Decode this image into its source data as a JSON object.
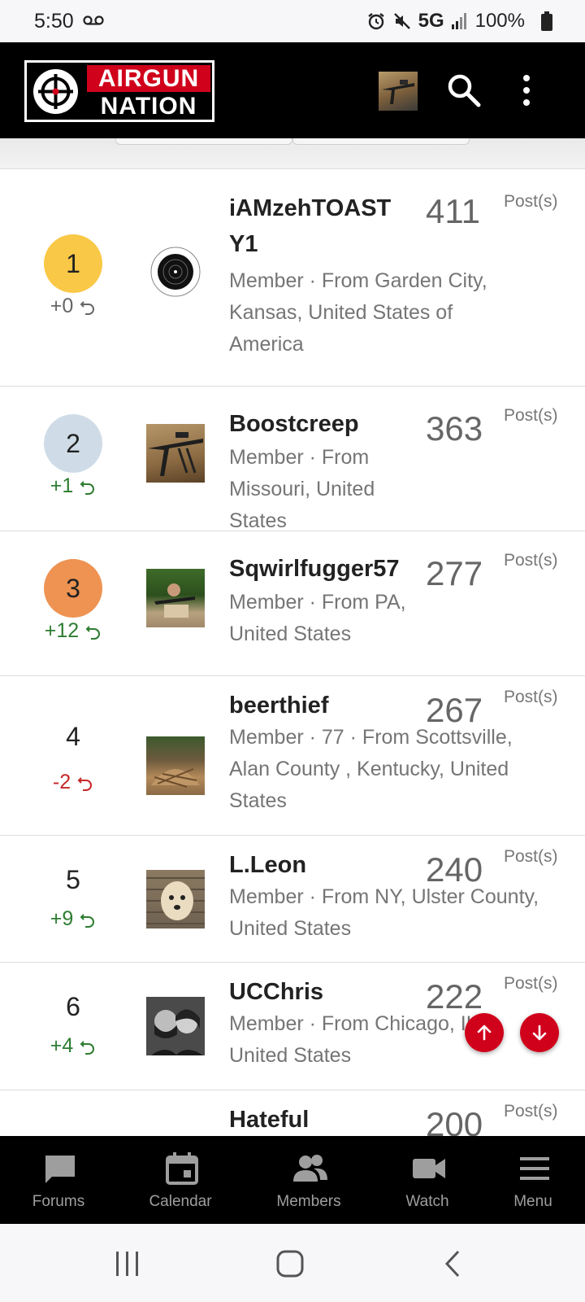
{
  "status_bar": {
    "time": "5:50",
    "network": "5G",
    "battery": "100%"
  },
  "header": {
    "logo_top": "AIRGUN",
    "logo_bottom": "NATION"
  },
  "leaderboard": {
    "posts_label": "Post(s)",
    "rows": [
      {
        "rank": "1",
        "delta": "+0",
        "username": "iAMzehTOAST Y1",
        "meta": "Member · From Garden City, Kansas, United States of America",
        "count": "411"
      },
      {
        "rank": "2",
        "delta": "+1",
        "username": "Boostcreep",
        "meta": "Member · From Missouri, United States",
        "count": "363"
      },
      {
        "rank": "3",
        "delta": "+12",
        "username": "Sqwirlfugger57",
        "meta": "Member · From PA, United States",
        "count": "277"
      },
      {
        "rank": "4",
        "delta": "-2",
        "username": "beerthief",
        "meta": "Member · 77 · From Scottsville, Alan County , Kentucky, United States",
        "count": "267"
      },
      {
        "rank": "5",
        "delta": "+9",
        "username": "L.Leon",
        "meta": "Member · From NY, Ulster County, United States",
        "count": "240"
      },
      {
        "rank": "6",
        "delta": "+4",
        "username": "UCChris",
        "meta": "Member · From Chicago, IL, United States",
        "count": "222"
      },
      {
        "rank": "",
        "delta": "",
        "username": "Hateful",
        "meta": "",
        "count": "200"
      }
    ]
  },
  "bottom_nav": {
    "items": [
      {
        "label": "Forums",
        "icon": "chat-icon"
      },
      {
        "label": "Calendar",
        "icon": "calendar-icon"
      },
      {
        "label": "Members",
        "icon": "members-icon"
      },
      {
        "label": "Watch",
        "icon": "video-icon"
      },
      {
        "label": "Menu",
        "icon": "menu-icon"
      }
    ]
  },
  "colors": {
    "brand_red": "#d0021b",
    "gold": "#f9c846",
    "silver": "#cfdce8",
    "bronze": "#ee9352",
    "positive": "#2e7d32",
    "negative": "#c62828"
  }
}
